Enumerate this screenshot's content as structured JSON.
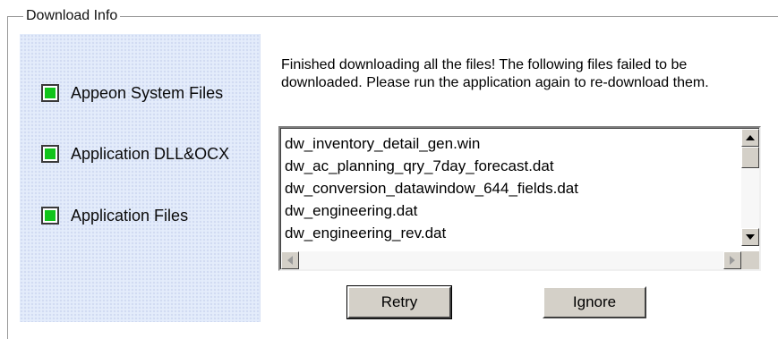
{
  "group": {
    "title": "Download Info"
  },
  "steps": [
    {
      "label": "Appeon System Files",
      "checked": true
    },
    {
      "label": "Application DLL&OCX",
      "checked": true
    },
    {
      "label": "Application Files",
      "checked": true
    }
  ],
  "message": "Finished downloading all the files! The following files failed to be downloaded. Please run the application again to re-download them.",
  "failed_files": [
    "dw_inventory_detail_gen.win",
    "dw_ac_planning_qry_7day_forecast.dat",
    "dw_conversion_datawindow_644_fields.dat",
    "dw_engineering.dat",
    "dw_engineering_rev.dat"
  ],
  "buttons": {
    "retry": "Retry",
    "ignore": "Ignore"
  },
  "colors": {
    "check": "#10c41a",
    "panel": "#e4ecfb",
    "button_face": "#d4d0c8"
  }
}
